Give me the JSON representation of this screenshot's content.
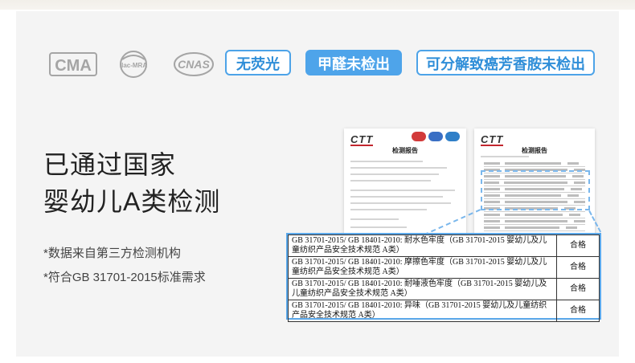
{
  "logos": {
    "cma": "CMA",
    "ilac": "ilac-MRA",
    "cnas": "CNAS"
  },
  "tags": [
    "无荧光",
    "甲醛未检出",
    "可分解致癌芳香胺未检出"
  ],
  "headline": {
    "line1": "已通过国家",
    "line2": "婴幼儿A类检测"
  },
  "notes": [
    "*数据来自第三方检测机构",
    "*符合GB 31701-2015标准需求"
  ],
  "report": {
    "brand": "CTT",
    "title": "检测报告"
  },
  "results_table": {
    "rows": [
      {
        "item": "GB 31701-2015/ GB 18401-2010: 耐水色牢度（GB 31701-2015 婴幼儿及儿童纺织产品安全技术规范 A类）",
        "result": "合格"
      },
      {
        "item": "GB 31701-2015/ GB 18401-2010: 摩擦色牢度（GB 31701-2015 婴幼儿及儿童纺织产品安全技术规范 A类）",
        "result": "合格"
      },
      {
        "item": "GB 31701-2015/ GB 18401-2010: 耐唾液色牢度（GB 31701-2015 婴幼儿及儿童纺织产品安全技术规范 A类）",
        "result": "合格"
      },
      {
        "item": "GB 31701-2015/ GB 18401-2010: 异味（GB 31701-2015 婴幼儿及儿童纺织产品安全技术规范 A类）",
        "result": "合格"
      }
    ]
  },
  "colors": {
    "accent": "#4ea4ea",
    "logo_gray": "#9a9a9a"
  }
}
